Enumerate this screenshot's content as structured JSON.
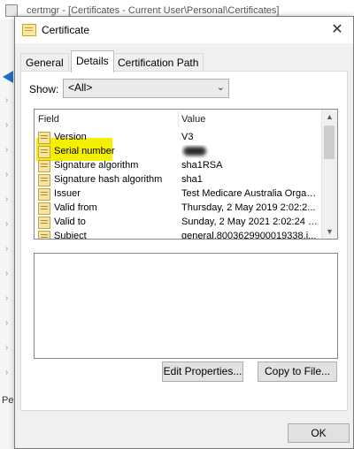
{
  "background_window": {
    "title": "certmgr - [Certificates - Current User\\Personal\\Certificates]",
    "status_text": "Pe"
  },
  "dialog": {
    "title": "Certificate",
    "close_glyph": "✕"
  },
  "tabs": [
    {
      "label": "General"
    },
    {
      "label": "Details"
    },
    {
      "label": "Certification Path"
    }
  ],
  "show": {
    "label": "Show:",
    "selected": "<All>"
  },
  "list": {
    "columns": {
      "field": "Field",
      "value": "Value"
    },
    "rows": [
      {
        "field": "Version",
        "value": "V3"
      },
      {
        "field": "Serial number",
        "value": ""
      },
      {
        "field": "Signature algorithm",
        "value": "sha1RSA"
      },
      {
        "field": "Signature hash algorithm",
        "value": "sha1"
      },
      {
        "field": "Issuer",
        "value": "Test Medicare Australia Organi..."
      },
      {
        "field": "Valid from",
        "value": "Thursday, 2 May 2019 2:02:2..."
      },
      {
        "field": "Valid to",
        "value": "Sunday, 2 May 2021 2:02:24 PM"
      },
      {
        "field": "Subject",
        "value": "general.8003629900019338.i..."
      }
    ]
  },
  "buttons": {
    "edit_properties": "Edit Properties...",
    "copy_to_file": "Copy to File...",
    "ok": "OK"
  },
  "colors": {
    "highlight": "#f5f000",
    "dialog_bg": "#f0f0f0"
  }
}
